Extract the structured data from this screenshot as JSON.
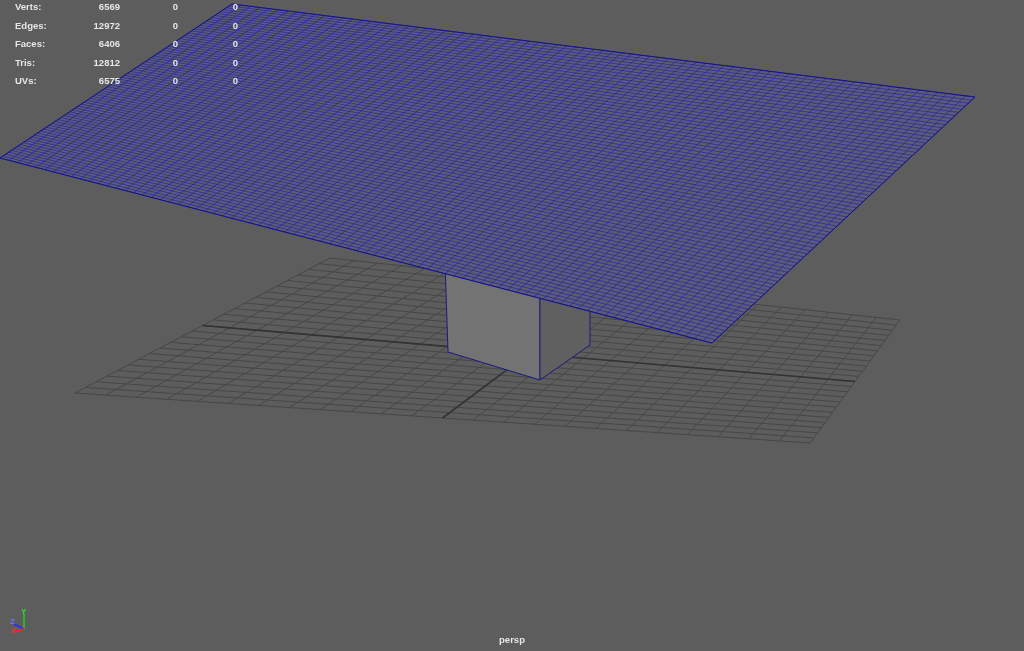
{
  "hud": {
    "rows": [
      {
        "label": "Verts:",
        "values": [
          "6569",
          "0",
          "0"
        ]
      },
      {
        "label": "Edges:",
        "values": [
          "12972",
          "0",
          "0"
        ]
      },
      {
        "label": "Faces:",
        "values": [
          "6406",
          "0",
          "0"
        ]
      },
      {
        "label": "Tris:",
        "values": [
          "12812",
          "0",
          "0"
        ]
      },
      {
        "label": "UVs:",
        "values": [
          "6575",
          "0",
          "0"
        ]
      }
    ]
  },
  "viewport": {
    "camera": "persp",
    "axis_labels": [
      "X",
      "Y",
      "Z"
    ]
  }
}
